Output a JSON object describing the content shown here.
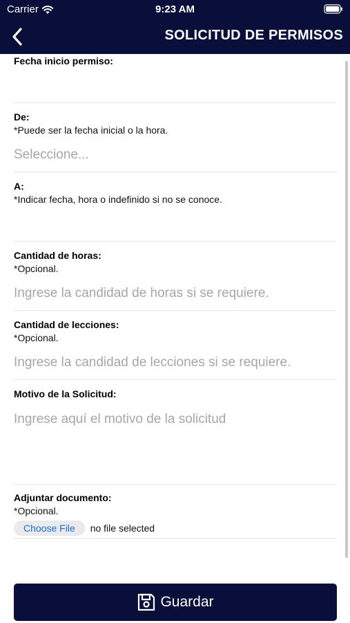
{
  "status_bar": {
    "carrier": "Carrier",
    "time": "9:23 AM",
    "wifi_icon": "wifi-icon",
    "battery_icon": "battery-icon"
  },
  "nav": {
    "back_icon": "chevron-left-icon",
    "title": "SOLICITUD DE PERMISOS"
  },
  "form": {
    "fecha_inicio": {
      "label": "Fecha inicio permiso:",
      "value": ""
    },
    "de": {
      "label": "De:",
      "note": "*Puede ser la fecha inicial o la hora.",
      "placeholder": "Seleccione..."
    },
    "a": {
      "label": "A:",
      "note": "*Indicar fecha, hora o indefinido si no se conoce.",
      "value": ""
    },
    "horas": {
      "label": "Cantidad de horas:",
      "note": "*Opcional.",
      "placeholder": "Ingrese la candidad de horas si se requiere."
    },
    "lecciones": {
      "label": "Cantidad de lecciones:",
      "note": "*Opcional.",
      "placeholder": "Ingrese la candidad de lecciones si se requiere."
    },
    "motivo": {
      "label": "Motivo de la Solicitud:",
      "placeholder": "Ingrese aquí el motivo de la solicitud"
    },
    "adjuntar": {
      "label": "Adjuntar documento:",
      "note": "*Opcional.",
      "button": "Choose File",
      "status": "no file selected"
    }
  },
  "save": {
    "icon": "save-icon",
    "label": "Guardar"
  },
  "colors": {
    "navy": "#0a0f3a",
    "placeholder": "#a6a6a6",
    "file_button_text": "#1a6fd1"
  }
}
